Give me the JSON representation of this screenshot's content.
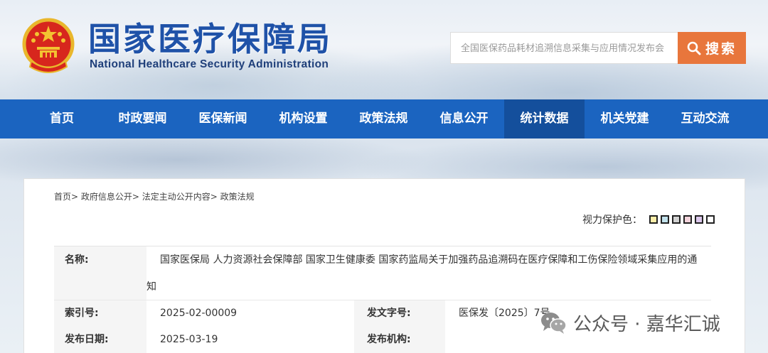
{
  "header": {
    "title_cn": "国家医疗保障局",
    "title_en": "National Healthcare Security Administration",
    "search_placeholder": "全国医保药品耗材追溯信息采集与应用情况发布会",
    "search_button": "搜索"
  },
  "nav": {
    "items": [
      "首页",
      "时政要闻",
      "医保新闻",
      "机构设置",
      "政策法规",
      "信息公开",
      "统计数据",
      "机关党建",
      "互动交流"
    ],
    "active_index": 6
  },
  "breadcrumb": "首页> 政府信息公开> 法定主动公开内容> 政策法规",
  "eye_care": {
    "label": "视力保护色：",
    "colors": [
      "#fbeea9",
      "#c2e2ec",
      "#d2d2d2",
      "#f4d4dc",
      "#dcc8ec",
      "#ffffff"
    ]
  },
  "meta": {
    "name_label": "名称:",
    "name_value": "国家医保局 人力资源社会保障部 国家卫生健康委 国家药监局关于加强药品追溯码在医疗保障和工伤保险领域采集应用的通知",
    "index_label": "索引号:",
    "index_value": "2025-02-00009",
    "doc_no_label": "发文字号:",
    "doc_no_value": "医保发〔2025〕7号",
    "date_label": "发布日期:",
    "date_value": "2025-03-19",
    "org_label": "发布机构:",
    "org_value": ""
  },
  "watermark": "公众号 · 嘉华汇诚"
}
